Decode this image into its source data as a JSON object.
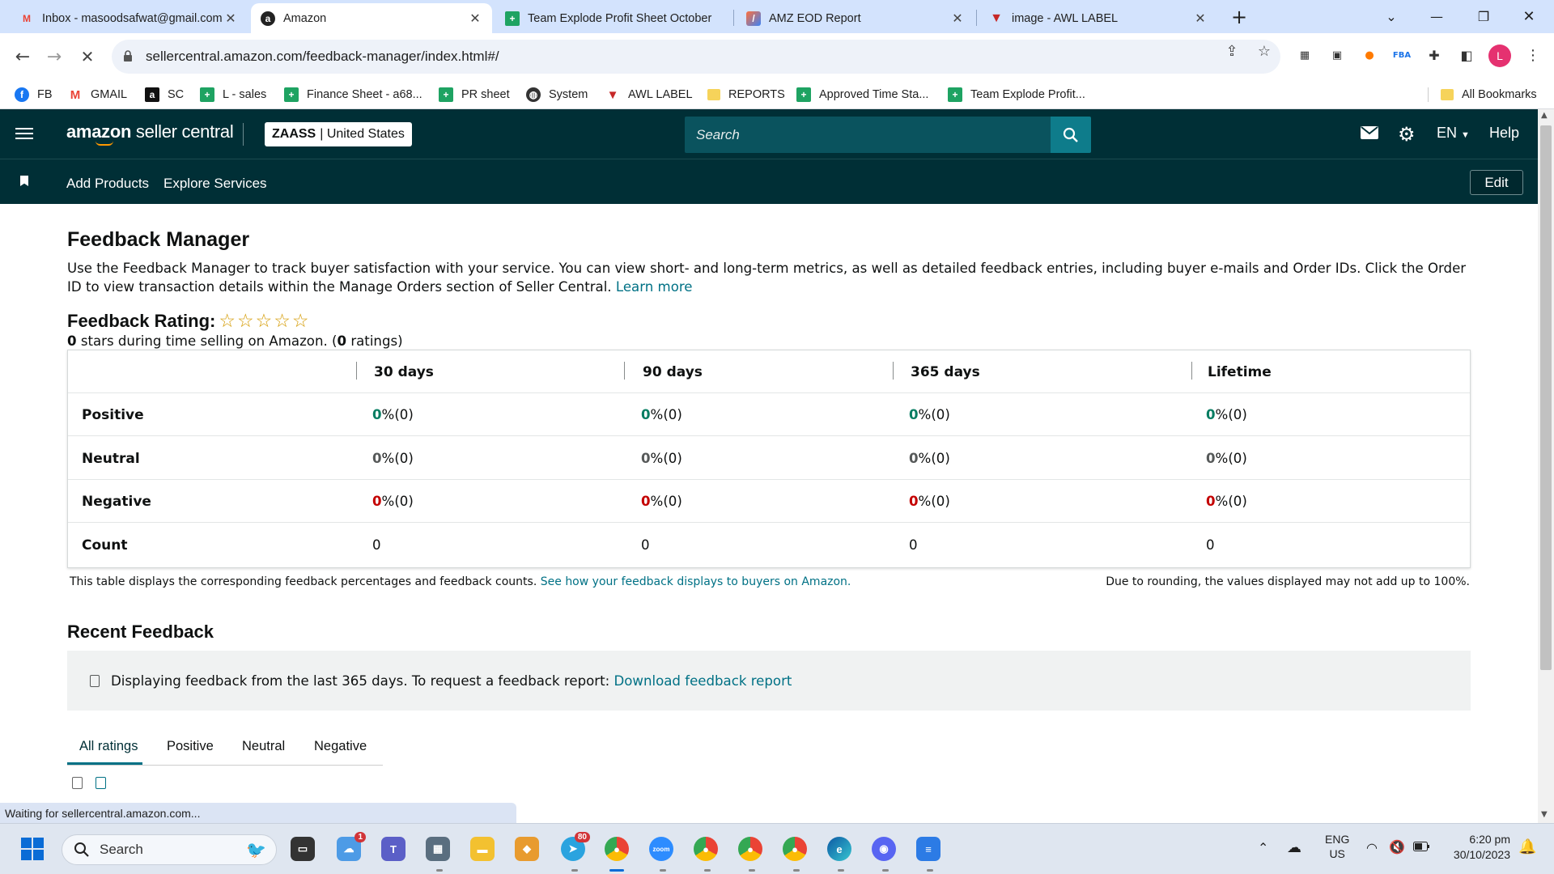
{
  "browser": {
    "tabs": [
      {
        "title": "Inbox - masoodsafwat@gmail.com",
        "icon": "gmail-icon",
        "active": false
      },
      {
        "title": "Amazon",
        "icon": "amazon-icon",
        "active": true
      },
      {
        "title": "Team Explode Profit Sheet October",
        "icon": "sheets-icon",
        "active": false
      },
      {
        "title": "AMZ EOD Report",
        "icon": "report-icon",
        "active": false
      },
      {
        "title": "image - AWL LABEL",
        "icon": "awl-icon",
        "active": false
      }
    ],
    "url": "sellercentral.amazon.com/feedback-manager/index.html#/",
    "profile_initial": "L",
    "bookmarks": [
      {
        "label": "FB",
        "icon": "facebook-icon"
      },
      {
        "label": "GMAIL",
        "icon": "gmail-icon"
      },
      {
        "label": "SC",
        "icon": "amazon-icon"
      },
      {
        "label": "L - sales",
        "icon": "sheets-icon"
      },
      {
        "label": "Finance Sheet - a68...",
        "icon": "sheets-icon"
      },
      {
        "label": "PR sheet",
        "icon": "sheets-icon"
      },
      {
        "label": "System",
        "icon": "globe-icon"
      },
      {
        "label": "AWL LABEL",
        "icon": "awl-icon"
      },
      {
        "label": "REPORTS",
        "icon": "folder-icon"
      },
      {
        "label": "Approved Time Sta...",
        "icon": "sheets-icon"
      },
      {
        "label": "Team Explode Profit...",
        "icon": "sheets-icon"
      }
    ],
    "all_bookmarks": "All Bookmarks",
    "status": "Waiting for sellercentral.amazon.com..."
  },
  "header": {
    "logo_bold": "amazon",
    "logo_rest": " seller central",
    "account_name": "ZAASS",
    "account_region": "| United States",
    "search_placeholder": "Search",
    "lang": "EN",
    "help": "Help"
  },
  "subnav": {
    "add_products": "Add Products",
    "explore_services": "Explore Services",
    "edit": "Edit"
  },
  "feedback": {
    "title": "Feedback Manager",
    "intro": "Use the Feedback Manager to track buyer satisfaction with your service. You can view short- and long-term metrics, as well as detailed feedback entries, including buyer e-mails and Order IDs. Click the Order ID to view transaction details within the Manage Orders section of Seller Central.",
    "learn_more": "Learn more",
    "rating_label": "Feedback Rating:",
    "stars": 0,
    "rating_sub_stars": "0",
    "rating_sub_mid": " stars during time selling on Amazon. (",
    "rating_sub_count": "0",
    "rating_sub_end": " ratings)",
    "columns": [
      "30 days",
      "90 days",
      "365 days",
      "Lifetime"
    ],
    "rows": [
      {
        "label": "Positive",
        "kind": "pos",
        "values": [
          {
            "n": "0",
            "p": " %(0)"
          },
          {
            "n": "0",
            "p": " %(0)"
          },
          {
            "n": "0",
            "p": " %(0)"
          },
          {
            "n": "0",
            "p": " %(0)"
          }
        ]
      },
      {
        "label": "Neutral",
        "kind": "neu",
        "values": [
          {
            "n": "0",
            "p": " %(0)"
          },
          {
            "n": "0",
            "p": " %(0)"
          },
          {
            "n": "0",
            "p": " %(0)"
          },
          {
            "n": "0",
            "p": " %(0)"
          }
        ]
      },
      {
        "label": "Negative",
        "kind": "neg",
        "values": [
          {
            "n": "0",
            "p": " %(0)"
          },
          {
            "n": "0",
            "p": " %(0)"
          },
          {
            "n": "0",
            "p": " %(0)"
          },
          {
            "n": "0",
            "p": " %(0)"
          }
        ]
      },
      {
        "label": "Count",
        "kind": "count",
        "values": [
          {
            "n": "0",
            "p": ""
          },
          {
            "n": "0",
            "p": ""
          },
          {
            "n": "0",
            "p": ""
          },
          {
            "n": "0",
            "p": ""
          }
        ]
      }
    ],
    "note_left": "This table displays the corresponding feedback percentages and feedback counts.",
    "note_left_link": "See how your feedback displays to buyers on Amazon.",
    "note_right": "Due to rounding, the values displayed may not add up to 100%.",
    "recent_title": "Recent Feedback",
    "recent_text": "Displaying feedback from the last 365 days. To request a feedback report:",
    "recent_link": "Download feedback report",
    "filter_tabs": [
      "All ratings",
      "Positive",
      "Neutral",
      "Negative"
    ]
  },
  "taskbar": {
    "search": "Search",
    "lang_top": "ENG",
    "lang_bottom": "US",
    "time": "6:20 pm",
    "date": "30/10/2023",
    "weather_badge": "1",
    "telegram_badge": "80"
  }
}
